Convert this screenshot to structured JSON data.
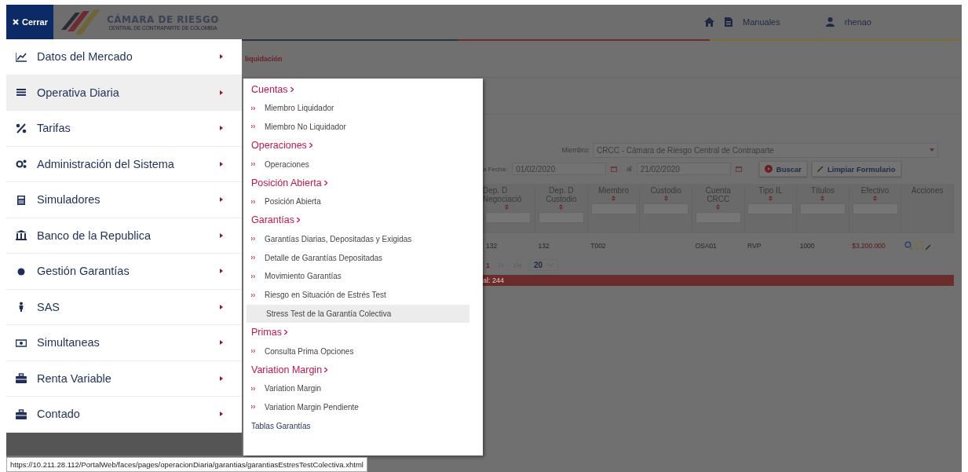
{
  "header": {
    "close_button": "Cerrar",
    "logo": {
      "title": "CÁMARA DE RIESGO",
      "subtitle": "CENTRAL DE CONTRAPARTE DE COLOMBIA"
    },
    "manuals": "Manuales",
    "user": "rhenao"
  },
  "breadcrumb": "liquidación",
  "main_menu": [
    {
      "label": "Datos del Mercado",
      "selected": false
    },
    {
      "label": "Operativa Diaria",
      "selected": true
    },
    {
      "label": "Tarifas",
      "selected": false
    },
    {
      "label": "Administración del Sistema",
      "selected": false
    },
    {
      "label": "Simuladores",
      "selected": false
    },
    {
      "label": "Banco de la Republica",
      "selected": false
    },
    {
      "label": "Gestión Garantías",
      "selected": false
    },
    {
      "label": "SAS",
      "selected": false
    },
    {
      "label": "Simultaneas",
      "selected": false
    },
    {
      "label": "Renta Variable",
      "selected": false
    },
    {
      "label": "Contado",
      "selected": false
    }
  ],
  "submenu": [
    {
      "kind": "heading",
      "label": "Cuentas"
    },
    {
      "kind": "link",
      "label": "Miembro Liquidador",
      "selected": false
    },
    {
      "kind": "link",
      "label": "Miembro No Liquidador",
      "selected": false
    },
    {
      "kind": "heading",
      "label": "Operaciones"
    },
    {
      "kind": "link",
      "label": "Operaciones",
      "selected": false
    },
    {
      "kind": "heading",
      "label": "Posición Abierta"
    },
    {
      "kind": "link",
      "label": "Posición Abierta",
      "selected": false
    },
    {
      "kind": "heading",
      "label": "Garantías"
    },
    {
      "kind": "link",
      "label": "Garantías Diarias, Depositadas y Exigidas",
      "selected": false
    },
    {
      "kind": "link",
      "label": "Detalle de Garantías Depositadas",
      "selected": false
    },
    {
      "kind": "link",
      "label": "Movimiento Garantías",
      "selected": false
    },
    {
      "kind": "link",
      "label": "Riesgo en Situación de Estrés Test",
      "selected": false
    },
    {
      "kind": "link",
      "label": "Stress Test de la Garantía Colectiva",
      "selected": true
    },
    {
      "kind": "heading",
      "label": "Primas"
    },
    {
      "kind": "link",
      "label": "Consulta Prima Opciones",
      "selected": false
    },
    {
      "kind": "heading",
      "label": "Variation Margin"
    },
    {
      "kind": "link",
      "label": "Variation Margin",
      "selected": false
    },
    {
      "kind": "link",
      "label": "Variation Margin Pendiente",
      "selected": false
    },
    {
      "kind": "section",
      "label": "Tablas Garantías"
    }
  ],
  "form": {
    "member_label": "Miembro:",
    "member_value": "CRCC - Cámara de Riesgo Central de Contraparte",
    "date_label": "a Fecha:",
    "date_from": "01/02/2020",
    "to_label": "al",
    "date_to": "21/02/2020",
    "search_button": "Buscar",
    "clear_button": "Limpiar Formulario"
  },
  "table": {
    "columns": [
      {
        "label": "Dep. D Negociació",
        "sortable": true,
        "filter": true
      },
      {
        "label": "Dep. D Custodio",
        "sortable": true,
        "filter": true
      },
      {
        "label": "Miembro",
        "sortable": true,
        "filter": true
      },
      {
        "label": "Custodio",
        "sortable": true,
        "filter": true
      },
      {
        "label": "Cuenta CRCC",
        "sortable": true,
        "filter": true
      },
      {
        "label": "Tipo IL",
        "sortable": true,
        "filter": true
      },
      {
        "label": "Títulos",
        "sortable": true,
        "filter": true
      },
      {
        "label": "Efectivo",
        "sortable": true,
        "filter": true
      },
      {
        "label": "Acciones",
        "sortable": false,
        "filter": false
      }
    ],
    "rows": [
      [
        "132",
        "132",
        "T002",
        "",
        "OSA01",
        "RVP",
        "1000",
        "$3.200.000"
      ]
    ]
  },
  "paginator": {
    "current_page": "1",
    "page_size": "20"
  },
  "total": "al: 244",
  "status_url": "https://10.211.28.112/PortalWeb/faces/pages/operacionDiaria/garantias/garantiasEstresTestColectiva.xhtml"
}
